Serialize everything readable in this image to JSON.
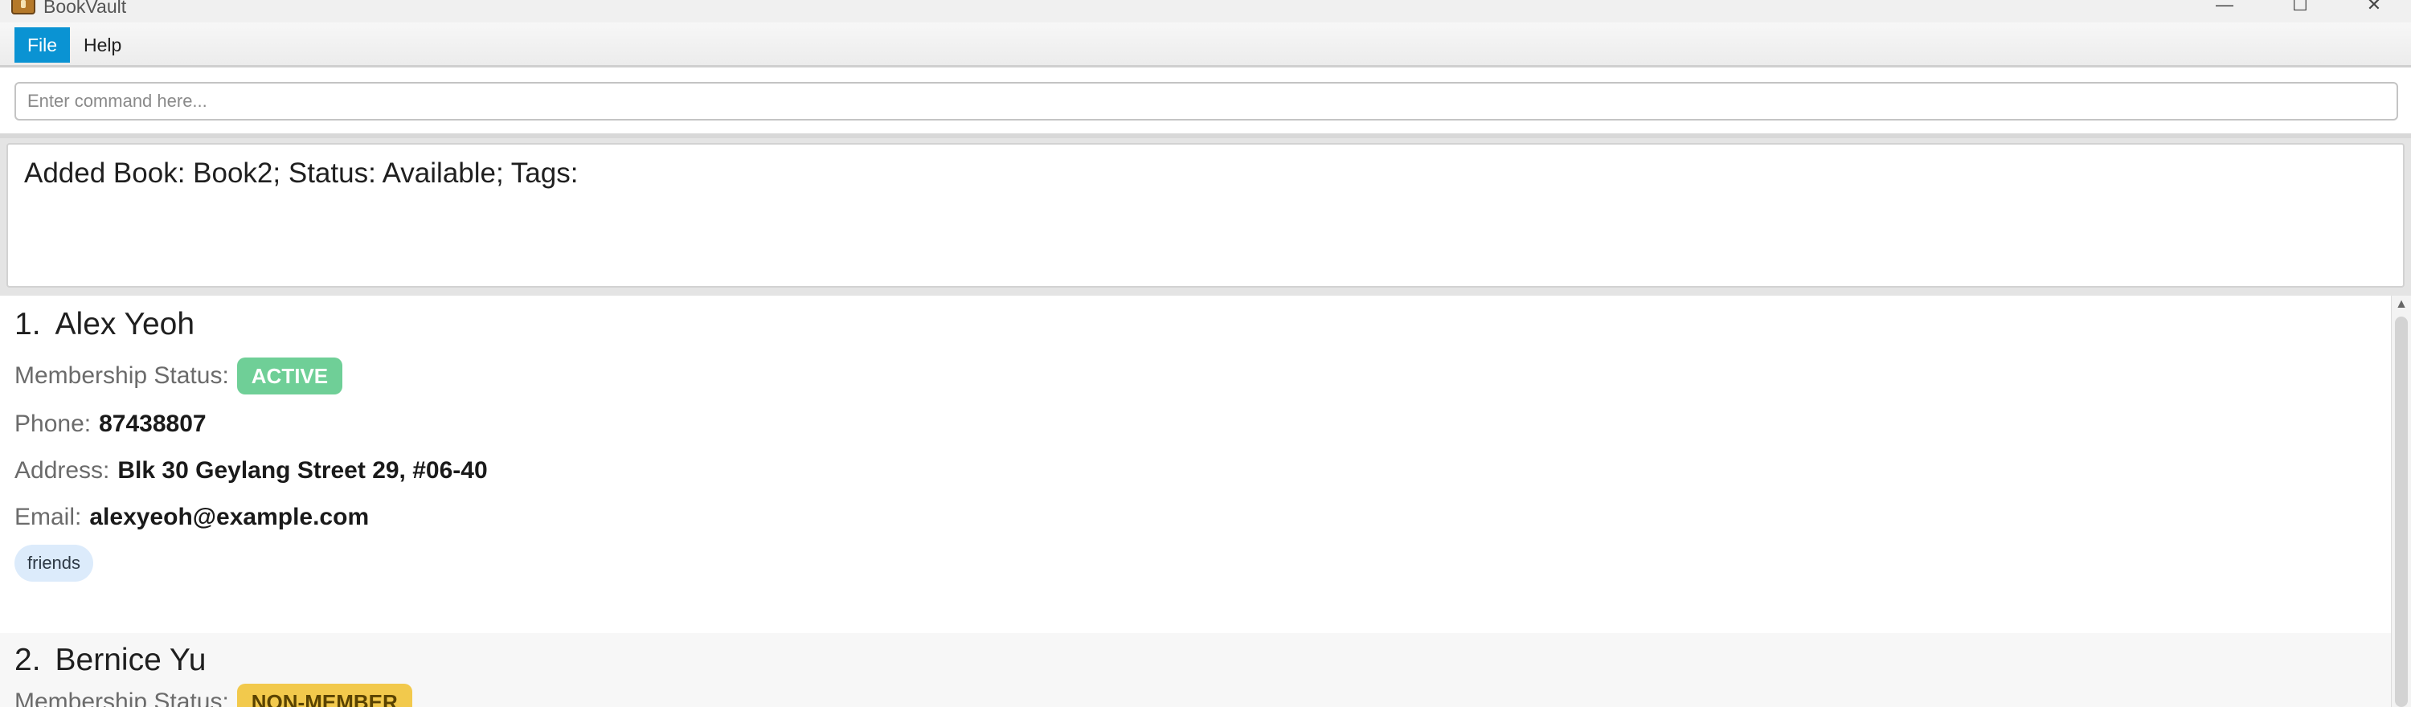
{
  "window": {
    "title": "BookVault",
    "controls": {
      "minimize": "—",
      "maximize": "☐",
      "close": "✕"
    }
  },
  "menu": {
    "items": [
      {
        "label": "File",
        "selected": true
      },
      {
        "label": "Help",
        "selected": false
      }
    ]
  },
  "command": {
    "placeholder": "Enter command here...",
    "value": ""
  },
  "result": {
    "text": "Added Book: Book2; Status: Available; Tags:"
  },
  "persons": [
    {
      "index": "1.",
      "name": "Alex Yeoh",
      "membership_label": "Membership Status:",
      "membership_status": "ACTIVE",
      "phone_label": "Phone:",
      "phone": "87438807",
      "address_label": "Address:",
      "address": "Blk 30 Geylang Street 29, #06-40",
      "email_label": "Email:",
      "email": "alexyeoh@example.com",
      "tags": [
        "friends"
      ]
    },
    {
      "index": "2.",
      "name": "Bernice Yu",
      "membership_label": "Membership Status:",
      "membership_status": "NON-MEMBER"
    }
  ],
  "colors": {
    "menu_selected": "#0a93d3",
    "badge_active": "#6fcf97",
    "badge_non_member": "#f2c94c",
    "tag_background": "#dcebfb"
  },
  "icons": {
    "app": "app-book-icon",
    "scroll_up": "chevron-up-icon"
  }
}
